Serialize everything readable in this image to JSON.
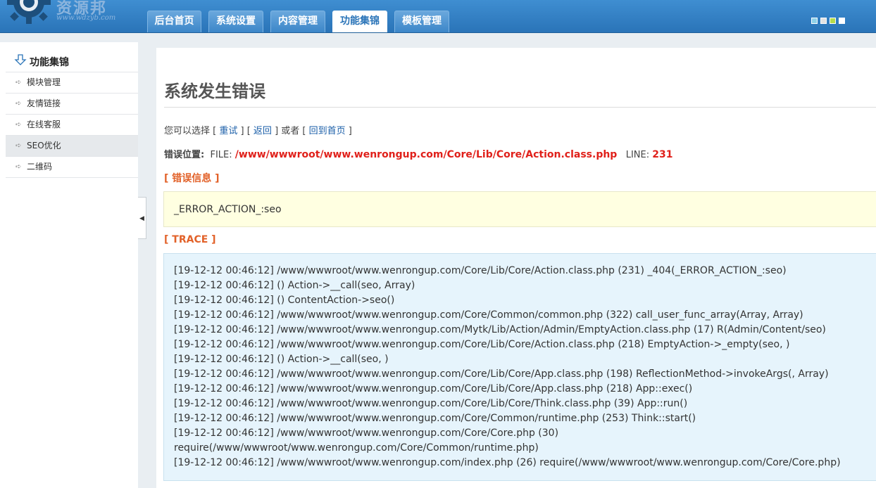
{
  "header": {
    "logo_text": "资源邦",
    "logo_url": "www.wdzyb.com",
    "tabs": [
      {
        "label": "后台首页",
        "active": false
      },
      {
        "label": "系统设置",
        "active": false
      },
      {
        "label": "内容管理",
        "active": false
      },
      {
        "label": "功能集锦",
        "active": true
      },
      {
        "label": "模板管理",
        "active": false
      }
    ],
    "skin_colors": [
      "#8fd1e8",
      "#e2e2e2",
      "#b6dc4a",
      "#ffffff"
    ]
  },
  "sidebar": {
    "title": "功能集锦",
    "items": [
      {
        "label": "模块管理",
        "active": false
      },
      {
        "label": "友情链接",
        "active": false
      },
      {
        "label": "在线客服",
        "active": false
      },
      {
        "label": "SEO优化",
        "active": true
      },
      {
        "label": "二维码",
        "active": false
      }
    ],
    "toggle": "◀"
  },
  "main": {
    "title": "系统发生错误",
    "choice": {
      "prefix": "您可以选择",
      "retry": "重试",
      "back": "返回",
      "or": "或者",
      "home": "回到首页"
    },
    "location": {
      "label": "错误位置:",
      "file_label": "FILE:",
      "file": "/www/wwwroot/www.wenrongup.com/Core/Lib/Core/Action.class.php",
      "line_label": "LINE:",
      "line": "231"
    },
    "error_info_heading": "[ 错误信息 ]",
    "error_message": "_ERROR_ACTION_:seo",
    "trace_heading": "[ TRACE ]",
    "trace": [
      "[19-12-12 00:46:12] /www/wwwroot/www.wenrongup.com/Core/Lib/Core/Action.class.php (231) _404(_ERROR_ACTION_:seo)",
      "[19-12-12 00:46:12] () Action->__call(seo, Array)",
      "[19-12-12 00:46:12] () ContentAction->seo()",
      "[19-12-12 00:46:12] /www/wwwroot/www.wenrongup.com/Core/Common/common.php (322) call_user_func_array(Array, Array)",
      "[19-12-12 00:46:12] /www/wwwroot/www.wenrongup.com/Mytk/Lib/Action/Admin/EmptyAction.class.php (17) R(Admin/Content/seo)",
      "[19-12-12 00:46:12] /www/wwwroot/www.wenrongup.com/Core/Lib/Core/Action.class.php (218) EmptyAction->_empty(seo, )",
      "[19-12-12 00:46:12] () Action->__call(seo, )",
      "[19-12-12 00:46:12] /www/wwwroot/www.wenrongup.com/Core/Lib/Core/App.class.php (198) ReflectionMethod->invokeArgs(, Array)",
      "[19-12-12 00:46:12] /www/wwwroot/www.wenrongup.com/Core/Lib/Core/App.class.php (218) App::exec()",
      "[19-12-12 00:46:12] /www/wwwroot/www.wenrongup.com/Core/Lib/Core/Think.class.php (39) App::run()",
      "[19-12-12 00:46:12] /www/wwwroot/www.wenrongup.com/Core/Common/runtime.php (253) Think::start()",
      "[19-12-12 00:46:12] /www/wwwroot/www.wenrongup.com/Core/Core.php (30)",
      "require(/www/wwwroot/www.wenrongup.com/Core/Common/runtime.php)",
      "[19-12-12 00:46:12] /www/wwwroot/www.wenrongup.com/index.php (26) require(/www/wwwroot/www.wenrongup.com/Core/Core.php)"
    ]
  }
}
